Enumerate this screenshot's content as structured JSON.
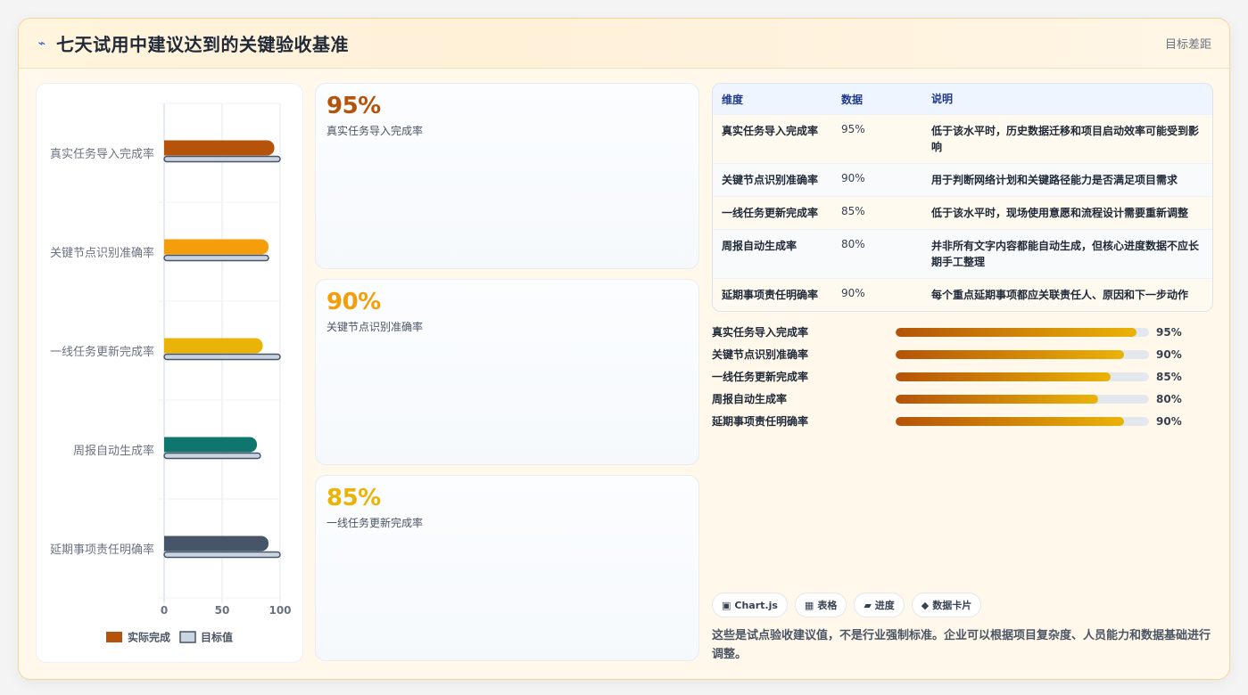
{
  "header": {
    "icon": "lightning-icon",
    "title": "七天试用中建议达到的关键验收基准",
    "right_text": "目标差距"
  },
  "colors": {
    "actual": [
      "#b45309",
      "#f59e0b",
      "#eab308",
      "#0f766e",
      "#475569"
    ],
    "target_fill": "#cbd5e1",
    "target_stroke": "#475569"
  },
  "chart_data": {
    "type": "bar",
    "orientation": "horizontal",
    "categories": [
      "真实任务导入完成率",
      "关键节点识别准确率",
      "一线任务更新完成率",
      "周报自动生成率",
      "延期事项责任明确率"
    ],
    "series": [
      {
        "name": "实际完成",
        "values": [
          95,
          90,
          85,
          80,
          90
        ]
      },
      {
        "name": "目标值",
        "values": [
          100,
          90,
          100,
          83,
          100
        ]
      }
    ],
    "xlim": [
      0,
      100
    ],
    "xticks": [
      "0",
      "50",
      "100"
    ],
    "legend": "bottom",
    "grid": true
  },
  "kpis": [
    {
      "value": "95%",
      "label": "真实任务导入完成率",
      "color": "#b45309"
    },
    {
      "value": "90%",
      "label": "关键节点识别准确率",
      "color": "#f59e0b"
    },
    {
      "value": "85%",
      "label": "一线任务更新完成率",
      "color": "#eab308"
    }
  ],
  "table": {
    "headers": [
      "维度",
      "数据",
      "说明"
    ],
    "rows": [
      {
        "dim": "真实任务导入完成率",
        "val": "95%",
        "desc": "低于该水平时，历史数据迁移和项目启动效率可能受到影响"
      },
      {
        "dim": "关键节点识别准确率",
        "val": "90%",
        "desc": "用于判断网络计划和关键路径能力是否满足项目需求"
      },
      {
        "dim": "一线任务更新完成率",
        "val": "85%",
        "desc": "低于该水平时，现场使用意愿和流程设计需要重新调整"
      },
      {
        "dim": "周报自动生成率",
        "val": "80%",
        "desc": "并非所有文字内容都能自动生成，但核心进度数据不应长期手工整理"
      },
      {
        "dim": "延期事项责任明确率",
        "val": "90%",
        "desc": "每个重点延期事项都应关联责任人、原因和下一步动作"
      }
    ]
  },
  "progress": [
    {
      "label": "真实任务导入完成率",
      "value": 95,
      "text": "95%"
    },
    {
      "label": "关键节点识别准确率",
      "value": 90,
      "text": "90%"
    },
    {
      "label": "一线任务更新完成率",
      "value": 85,
      "text": "85%"
    },
    {
      "label": "周报自动生成率",
      "value": 80,
      "text": "80%"
    },
    {
      "label": "延期事项责任明确率",
      "value": 90,
      "text": "90%"
    }
  ],
  "tags": [
    {
      "icon": "▣",
      "label": "Chart.js"
    },
    {
      "icon": "▦",
      "label": "表格"
    },
    {
      "icon": "▰",
      "label": "进度"
    },
    {
      "icon": "◆",
      "label": "数据卡片"
    }
  ],
  "note": "这些是试点验收建议值，不是行业强制标准。企业可以根据项目复杂度、人员能力和数据基础进行调整。"
}
